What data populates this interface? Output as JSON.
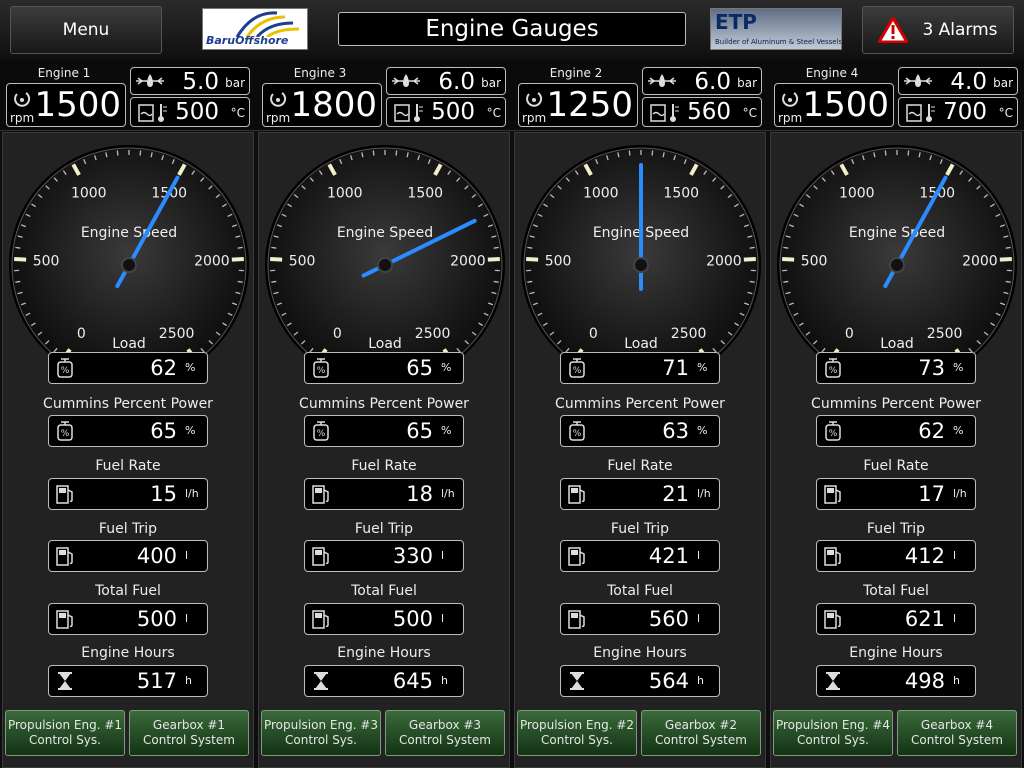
{
  "header": {
    "menu_label": "Menu",
    "title": "Engine Gauges",
    "alarms_label": "3 Alarms"
  },
  "logos": {
    "left": "BaruOffshore",
    "right": "ETP",
    "right_tagline": "Builder of Aluminum & Steel Vessels"
  },
  "gauge_labels": {
    "title": "Engine Speed",
    "subtitle": "Load",
    "ticks": [
      "0",
      "500",
      "1000",
      "1500",
      "2000",
      "2500"
    ]
  },
  "units": {
    "rpm": "rpm",
    "pressure": "bar",
    "temp": "°C",
    "percent": "%",
    "rate": "l/h",
    "litre": "l",
    "hours": "h"
  },
  "metric_labels": {
    "power": "Cummins Percent Power",
    "fuel_rate": "Fuel Rate",
    "fuel_trip": "Fuel Trip",
    "total_fuel": "Total Fuel",
    "engine_hours": "Engine Hours"
  },
  "colors": {
    "needle": "#2a8cff",
    "button_green": "#1f4a1f"
  },
  "engines": [
    {
      "name": "Engine 1",
      "rpm": "1500",
      "pressure": "5.0",
      "temp": "500",
      "load": "62",
      "power": "65",
      "fuel_rate": "15",
      "fuel_trip": "400",
      "total_fuel": "500",
      "engine_hours": "517",
      "button1": "Propulsion Eng. #1\nControl Sys.",
      "button2": "Gearbox #1\nControl System"
    },
    {
      "name": "Engine 3",
      "rpm": "1800",
      "pressure": "6.0",
      "temp": "500",
      "load": "65",
      "power": "65",
      "fuel_rate": "18",
      "fuel_trip": "330",
      "total_fuel": "500",
      "engine_hours": "645",
      "button1": "Propulsion Eng. #3\nControl Sys.",
      "button2": "Gearbox #3\nControl System"
    },
    {
      "name": "Engine 2",
      "rpm": "1250",
      "pressure": "6.0",
      "temp": "560",
      "load": "71",
      "power": "63",
      "fuel_rate": "21",
      "fuel_trip": "421",
      "total_fuel": "560",
      "engine_hours": "564",
      "button1": "Propulsion Eng. #2\nControl Sys.",
      "button2": "Gearbox #2\nControl System"
    },
    {
      "name": "Engine 4",
      "rpm": "1500",
      "pressure": "4.0",
      "temp": "700",
      "load": "73",
      "power": "62",
      "fuel_rate": "17",
      "fuel_trip": "412",
      "total_fuel": "621",
      "engine_hours": "498",
      "button1": "Propulsion Eng. #4\nControl Sys.",
      "button2": "Gearbox #4\nControl System"
    }
  ]
}
